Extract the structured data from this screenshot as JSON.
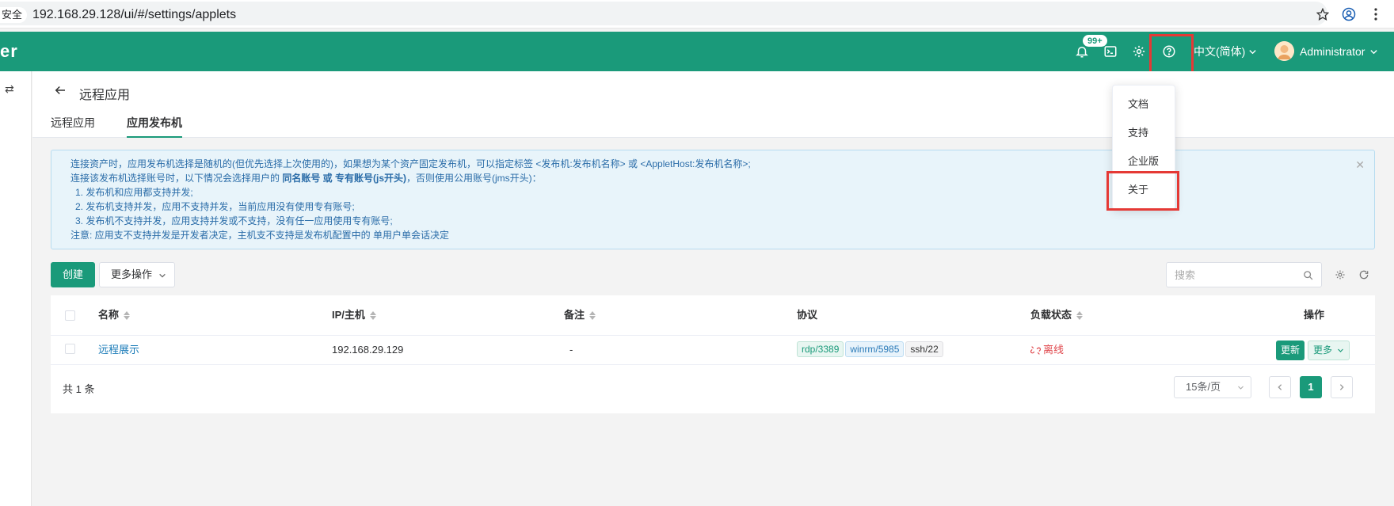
{
  "browser": {
    "insecure_label": "安全",
    "url": "192.168.29.128/ui/#/settings/applets"
  },
  "header": {
    "logo_fragment": "er",
    "notification_badge": "99+",
    "language": "中文(简体)",
    "user": "Administrator"
  },
  "page": {
    "title": "远程应用",
    "tabs": [
      {
        "label": "远程应用",
        "active": false
      },
      {
        "label": "应用发布机",
        "active": true
      }
    ]
  },
  "alert": {
    "line1": "连接资产时，应用发布机选择是随机的(但优先选择上次使用的)，如果想为某个资产固定发布机，可以指定标签 <发布机:发布机名称> 或 <AppletHost:发布机名称>;",
    "line2_prefix": "连接该发布机选择账号时，以下情况会选择用户的 ",
    "line2_bold": "同名账号 或 专有账号(js开头)",
    "line2_suffix": "，否则使用公用账号(jms开头)：",
    "item1": "1. 发布机和应用都支持并发;",
    "item2": "2. 发布机支持并发，应用不支持并发，当前应用没有使用专有账号;",
    "item3": "3. 发布机不支持并发，应用支持并发或不支持，没有任一应用使用专有账号;",
    "note": "注意: 应用支不支持并发是开发者决定，主机支不支持是发布机配置中的 单用户单会话决定"
  },
  "toolbar": {
    "create_label": "创建",
    "more_actions_label": "更多操作",
    "search_placeholder": "搜索"
  },
  "table": {
    "columns": [
      "名称",
      "IP/主机",
      "备注",
      "协议",
      "负载状态",
      "操作"
    ],
    "rows": [
      {
        "name": "远程展示",
        "ip": "192.168.29.129",
        "comment": "-",
        "protocols": [
          "rdp/3389",
          "winrm/5985",
          "ssh/22"
        ],
        "load_status": "离线",
        "update_label": "更新",
        "more_label": "更多"
      }
    ],
    "total": "共 1 条",
    "page_size": "15条/页",
    "current_page": "1"
  },
  "help_menu": {
    "items": [
      "文档",
      "支持",
      "企业版",
      "关于"
    ]
  },
  "colors": {
    "brand": "#1a9a7a",
    "alert_text": "#2a6ca8",
    "offline": "#e0484d",
    "annotation": "#e53935"
  }
}
